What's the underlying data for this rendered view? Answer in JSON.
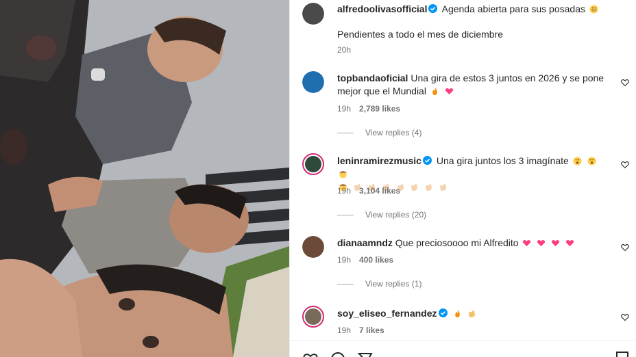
{
  "photo": {
    "alt_subject": "three-friends-selfie"
  },
  "post": {
    "author": "alfredoolivasofficial",
    "verified": true,
    "caption_line1": "Agenda abierta para sus posadas",
    "caption_emoji": "grinning-face-emoji",
    "caption_line2": "Pendientes a todo el mes de diciembre",
    "time": "20h"
  },
  "comments": [
    {
      "user": "topbandaoficial",
      "verified": false,
      "text_line1": "Una gira de estos 3 juntos en 2026 y se pone",
      "text_line2": "mejor que el Mundial",
      "emojis": [
        "fire-emoji",
        "heart-emoji"
      ],
      "time": "19h",
      "likes": "2,789 likes",
      "replies": "View replies (4)"
    },
    {
      "user": "leninramirezmusic",
      "verified": true,
      "text_line1": "Una gira juntos los 3 imagínate",
      "emojis": [
        "wow-face-emoji",
        "wow-face-emoji",
        "cowboy-emoji",
        "cowboy-emoji",
        "clap-emoji",
        "clap-emoji",
        "clap-emoji",
        "clap-emoji",
        "clap-emoji",
        "clap-emoji",
        "clap-emoji"
      ],
      "time": "19h",
      "likes": "3,104 likes",
      "replies": "View replies (20)"
    },
    {
      "user": "dianaamndz",
      "verified": false,
      "text_line1": "Que preciosoooo mi Alfredito",
      "emojis": [
        "heart-emoji",
        "heart-emoji",
        "heart-emoji",
        "heart-emoji"
      ],
      "time": "19h",
      "likes": "400 likes",
      "replies": "View replies (1)"
    },
    {
      "user": "soy_eliseo_fernandez",
      "verified": true,
      "text_line1": "",
      "emojis": [
        "fire-emoji",
        "clap-emoji"
      ],
      "time": "19h",
      "likes": "7 likes"
    }
  ],
  "colors": {
    "verified": "#0095f6",
    "heart": "#ff3040",
    "muted": "#737373",
    "story_ring": "#d62976"
  },
  "actions": [
    "like-icon",
    "comment-icon",
    "share-icon",
    "save-icon"
  ]
}
